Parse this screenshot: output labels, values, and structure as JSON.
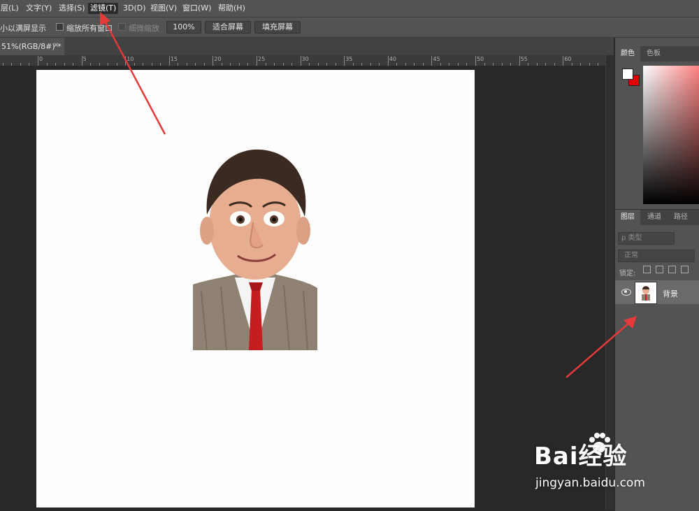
{
  "menubar": {
    "items": [
      "层(L)",
      "文字(Y)",
      "选择(S)",
      "滤镜(T)",
      "3D(D)",
      "视图(V)",
      "窗口(W)",
      "帮助(H)"
    ]
  },
  "options": {
    "resize_windows": "小以满屏显示",
    "zoom_all_windows": "缩放所有窗口",
    "scrubby_zoom": "细微缩放",
    "btn_100": "100%",
    "btn_fit": "适合屏幕",
    "btn_fill": "填充屏幕"
  },
  "document_tab": {
    "title": "51%(RGB/8#) *",
    "close": "×"
  },
  "ruler_labels": [
    "0",
    "5",
    "10",
    "15",
    "20",
    "25",
    "30",
    "35",
    "40",
    "45",
    "50",
    "55",
    "60"
  ],
  "color_panel": {
    "tabs": [
      "颜色",
      "色板"
    ],
    "foreground": "#ffffff",
    "background": "#e00000"
  },
  "layers_panel": {
    "tabs": [
      "图层",
      "通道",
      "路径"
    ],
    "filter_placeholder": "ρ 类型",
    "blend_mode": "正常",
    "lock_label": "锁定:",
    "layer_name": "背景"
  },
  "watermark": {
    "brand": "Bai经验",
    "url": "jingyan.baidu.com"
  },
  "annotation_color": "#e53a3a"
}
